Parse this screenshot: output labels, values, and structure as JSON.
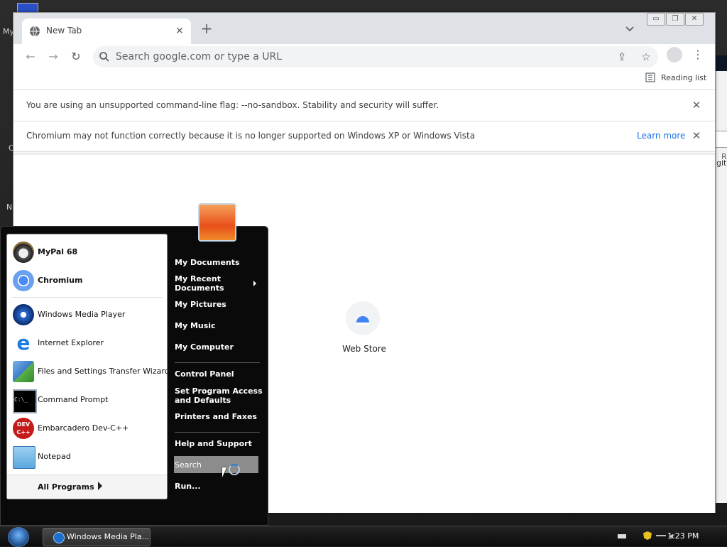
{
  "browser": {
    "tab": {
      "title": "New Tab"
    },
    "omnibox": {
      "placeholder": "Search google.com or type a URL"
    },
    "bookmarks": {
      "reading_list": "Reading list"
    },
    "infobars": [
      {
        "text": "You are using an unsupported command-line flag: --no-sandbox. Stability and security will suffer."
      },
      {
        "text": "Chromium may not function correctly because it is no longer supported on Windows XP or Windows Vista",
        "link": "Learn more"
      }
    ],
    "ntp": {
      "shortcut_label": "Web Store"
    }
  },
  "start_menu": {
    "pinned": [
      {
        "label": "MyPal 68",
        "icon": "mypal-icon"
      },
      {
        "label": "Chromium",
        "icon": "chromium-icon"
      }
    ],
    "recent": [
      {
        "label": "Windows Media Player",
        "icon": "media-player-icon"
      },
      {
        "label": "Internet Explorer",
        "icon": "internet-explorer-icon"
      },
      {
        "label": "Files and Settings Transfer Wizard",
        "icon": "transfer-wizard-icon"
      },
      {
        "label": "Command Prompt",
        "icon": "command-prompt-icon"
      },
      {
        "label": "Embarcadero Dev-C++",
        "icon": "devcpp-icon"
      },
      {
        "label": "Notepad",
        "icon": "notepad-icon"
      }
    ],
    "all_programs": "All Programs",
    "right": {
      "my_documents": "My Documents",
      "my_recent_documents_1": "My Recent",
      "my_recent_documents_2": "Documents",
      "my_pictures": "My Pictures",
      "my_music": "My Music",
      "my_computer": "My Computer",
      "control_panel": "Control Panel",
      "set_program_1": "Set Program Access",
      "set_program_2": "and Defaults",
      "printers": "Printers and Faxes",
      "help": "Help and Support",
      "search": "Search",
      "run": "Run..."
    }
  },
  "taskbar": {
    "task_label": "Windows Media Pla...",
    "clock": "1:23 PM"
  },
  "desktop_fragments": {
    "f1": "My",
    "f2": "C",
    "f3": "N",
    "f4": "Ra",
    "f5": "gita"
  },
  "colors": {
    "accent": "#1a73e8",
    "taskbar": "#0c0c0c",
    "highlight": "#8c8c8c"
  }
}
